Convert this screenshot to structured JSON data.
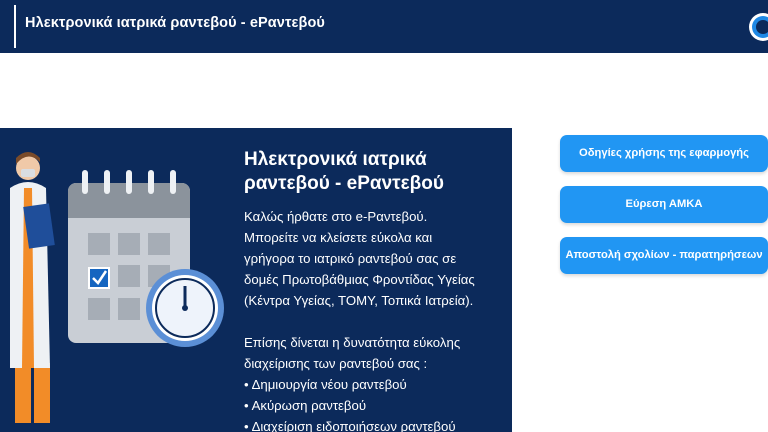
{
  "header": {
    "title": "Ηλεκτρονικά ιατρικά ραντεβού - eΡαντεβού"
  },
  "intro": {
    "heading_line1": "Ηλεκτρονικά ιατρικά",
    "heading_line2": "ραντεβού - eΡαντεβού",
    "lines_block1": [
      "Καλώς ήρθατε στο e-Ραντεβού.",
      "Μπορείτε να κλείσετε εύκολα και",
      "γρήγορα το ιατρικό ραντεβού σας σε",
      "δομές Πρωτοβάθμιας Φροντίδας Υγείας",
      "(Κέντρα Υγείας, ΤΟΜΥ, Τοπικά Ιατρεία)."
    ],
    "lines_block2": [
      "Επίσης δίνεται η δυνατότητα εύκολης",
      "διαχείρισης των ραντεβού σας :"
    ],
    "bullets": [
      "Δημιουργία νέου ραντεβού",
      "Ακύρωση ραντεβού",
      "Διαχείριση ειδοποιήσεων ραντεβού"
    ]
  },
  "sidebar_buttons": [
    {
      "label": "Οδηγίες χρήσης της εφαρμογής"
    },
    {
      "label": "Εύρεση ΑΜΚΑ"
    },
    {
      "label": "Αποστολή σχολίων - παρατηρήσεων"
    }
  ],
  "icons": {
    "logo": "logo-icon",
    "doctor": "doctor-illustration",
    "calendar": "calendar-icon",
    "clock": "clock-icon",
    "checkbox": "checkmark-icon"
  },
  "colors": {
    "navy": "#0c2a5b",
    "button_blue": "#2196f3",
    "calendar_gray": "#bfc5cc",
    "coat_orange": "#f28c28"
  }
}
